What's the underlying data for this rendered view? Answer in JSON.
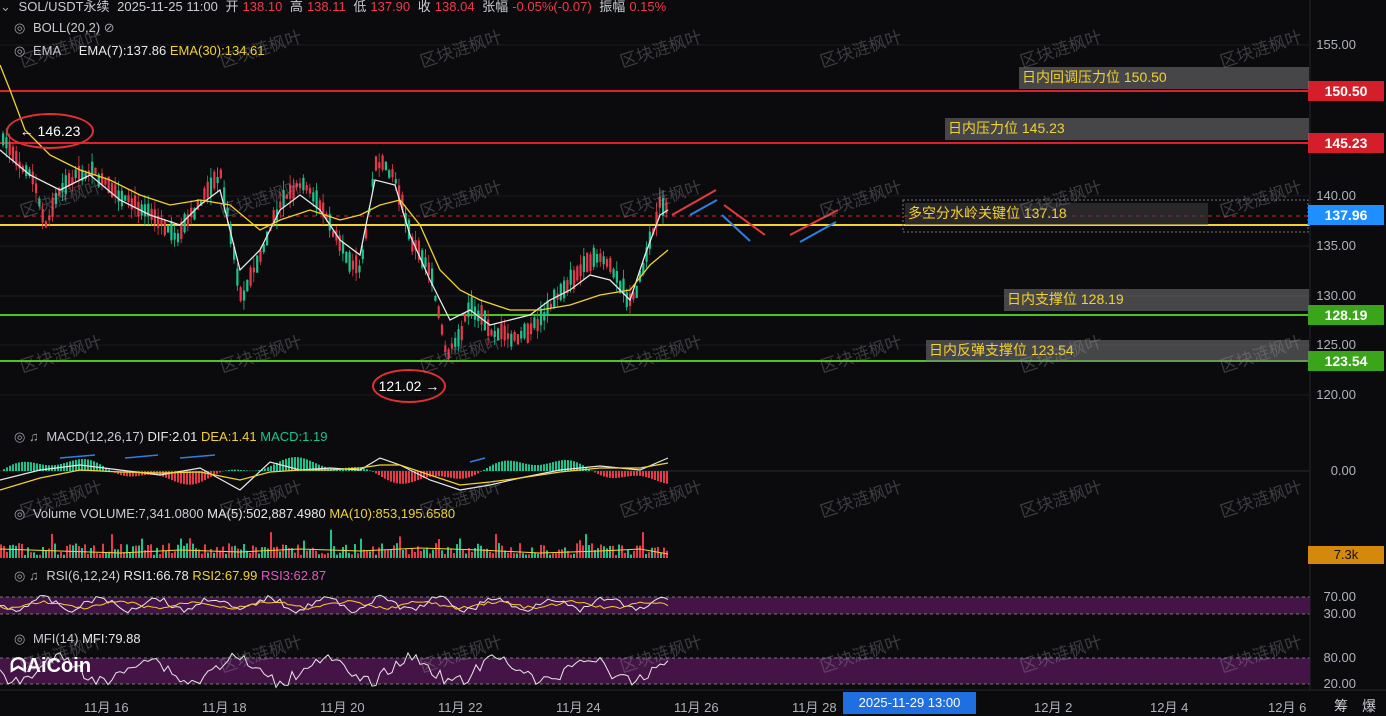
{
  "header": {
    "symbol": "SOL/USDT永续",
    "datetime": "2025-11-25 11:00",
    "open_label": "开",
    "open": "138.10",
    "high_label": "高",
    "high": "138.11",
    "low_label": "低",
    "low": "137.90",
    "close_label": "收",
    "close": "138.04",
    "change_label": "张幅",
    "change": "-0.05%(-0.07)",
    "amp_label": "振幅",
    "amp": "0.15%"
  },
  "indicators": {
    "boll": "BOLL(20,2)",
    "ema_label": "EMA",
    "ema7": "EMA(7):137.86",
    "ema30": "EMA(30):134.61",
    "macd_label": "MACD(12,26,17)",
    "dif": "DIF:2.01",
    "dea": "DEA:1.41",
    "macd": "MACD:1.19",
    "volume_label": "Volume",
    "volume": "VOLUME:7,341.0800",
    "ma5": "MA(5):502,887.4980",
    "ma10": "MA(10):853,195.6580",
    "rsi_label": "RSI(6,12,24)",
    "rsi1": "RSI1:66.78",
    "rsi2": "RSI2:67.99",
    "rsi3": "RSI3:62.87",
    "mfi_label": "MFI(14)",
    "mfi": "MFI:79.88"
  },
  "price_axis": [
    "155.00",
    "140.00",
    "135.00",
    "130.00",
    "125.00",
    "120.00"
  ],
  "macd_axis": "0.00",
  "vol_tag": "7.3k",
  "rsi_axis": [
    "70.00",
    "30.00"
  ],
  "mfi_axis": [
    "80.00",
    "20.00"
  ],
  "levels": {
    "retrace_resist_label": "日内回调压力位 150.50",
    "retrace_resist": "150.50",
    "resist_label": "日内压力位 145.23",
    "resist": "145.23",
    "pivot_label": "多空分水岭关键位 137.18",
    "current_price": "137.96",
    "support_label": "日内支撑位 128.19",
    "support": "128.19",
    "rebound_support_label": "日内反弹支撑位 123.54",
    "rebound_support": "123.54"
  },
  "annotations": {
    "high_marker": "← 146.23",
    "low_marker": "121.02 →"
  },
  "x_axis": [
    "11月 16",
    "11月 18",
    "11月 20",
    "11月 22",
    "11月 24",
    "11月 26",
    "11月 28",
    "12月 2",
    "12月 4",
    "12月 6"
  ],
  "crosshair_time": "2025-11-29 13:00",
  "brand": "AiCoin",
  "corner_buttons": [
    "筹",
    "爆"
  ],
  "watermark": "区块涟枫叶",
  "colors": {
    "resistance": "#e01e2d",
    "support": "#4cc520",
    "pivot": "#f2d22e",
    "current": "#1f8fff",
    "volume_tag": "#d4880c"
  }
}
